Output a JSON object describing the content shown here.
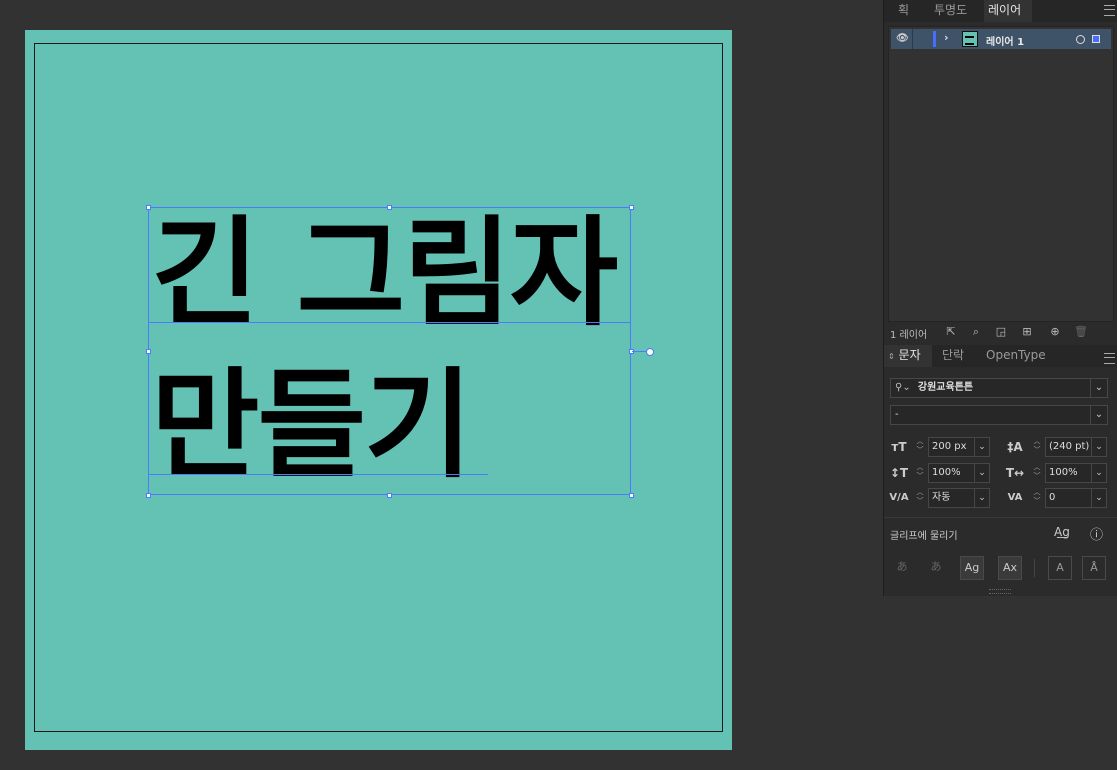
{
  "canvas": {
    "artboard_color": "#64c2b5",
    "headline_lines": [
      "긴 그림자",
      "만들기"
    ]
  },
  "layers_panel": {
    "tabs": [
      "획",
      "투명도",
      "레이어"
    ],
    "active_tab": "레이어",
    "layer_name": "레이어 1",
    "footer_count": "1 레이어",
    "footer_icons": [
      "export-icon",
      "search-icon",
      "clip-icon",
      "sublayer-icon",
      "add-layer-icon",
      "trash-icon"
    ]
  },
  "character_panel": {
    "tabs": [
      "문자",
      "단락",
      "OpenType"
    ],
    "active_tab": "문자",
    "font_family": "강원교육튼튼",
    "font_style": "-",
    "font_size": "200 px",
    "leading": "(240 pt)",
    "vertical_scale": "100%",
    "horizontal_scale": "100%",
    "kerning": "자동",
    "tracking": "0",
    "glyph_snap_label": "글리프에 물리기",
    "chevron_glyph": "⌄"
  }
}
